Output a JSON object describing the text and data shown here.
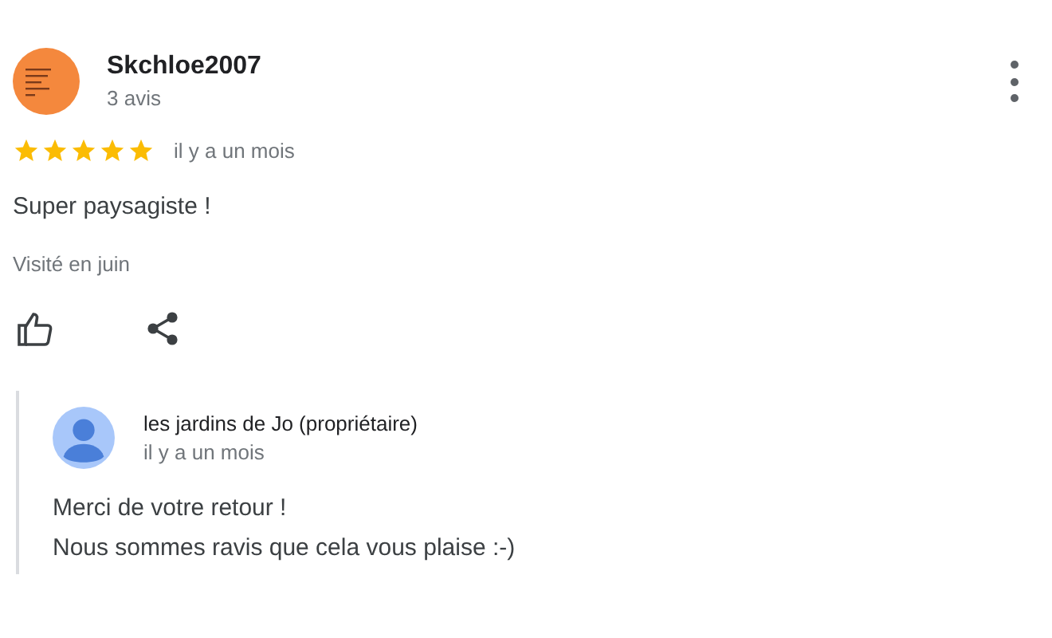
{
  "review": {
    "author": "Skchloe2007",
    "review_count": "3 avis",
    "stars": 5,
    "time": "il y a un mois",
    "text": "Super paysagiste !",
    "visit": "Visité en juin"
  },
  "reply": {
    "author": "les jardins de Jo (propriétaire)",
    "time": "il y a un mois",
    "lines": [
      "Merci de votre retour !",
      "Nous sommes ravis que cela vous plaise :-)"
    ]
  }
}
